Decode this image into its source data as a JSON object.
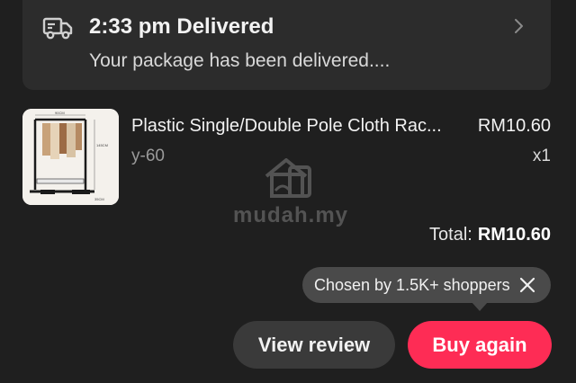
{
  "delivery": {
    "title": "2:33 pm Delivered",
    "subtitle": "Your package has been delivered....",
    "icon": "delivery-truck-icon"
  },
  "product": {
    "name": "Plastic Single/Double Pole Cloth Rac...",
    "price": "RM10.60",
    "variant": "y-60",
    "quantity": "x1",
    "thumbnail_labels": [
      "90CM",
      "145CM",
      "35CM"
    ]
  },
  "watermark": {
    "text": "mudah.my"
  },
  "total": {
    "label": "Total:",
    "value": "RM10.60"
  },
  "tooltip": {
    "text": "Chosen by 1.5K+ shoppers"
  },
  "actions": {
    "view_review": "View review",
    "buy_again": "Buy again"
  },
  "colors": {
    "background": "#1f1f1f",
    "card": "#2c2c2c",
    "accent": "#fe2c55",
    "secondary_button": "#3a3a3a",
    "tooltip": "#4a4a4a"
  }
}
